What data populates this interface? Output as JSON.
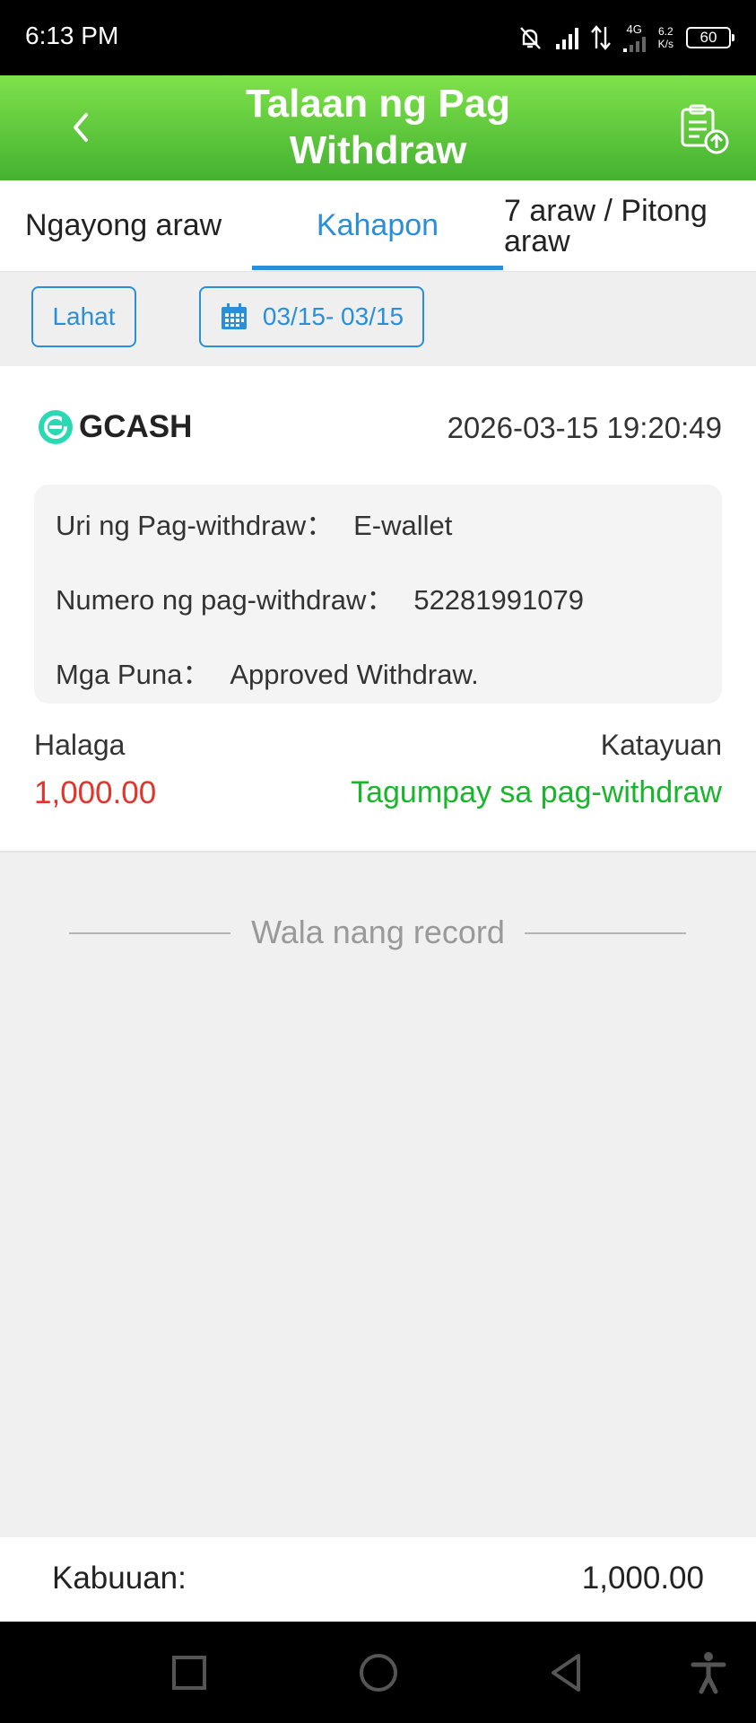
{
  "status_bar": {
    "time": "6:13 PM",
    "network": "4G",
    "speed_value": "6.2",
    "speed_unit": "K/s",
    "battery": "60",
    "icons": [
      "mute-bell-icon",
      "signal-icon",
      "data-arrows-icon",
      "signal-icon",
      "battery-icon"
    ]
  },
  "header": {
    "title": "Talaan ng Pag Withdraw",
    "back_icon": "chevron-left-icon",
    "action_icon": "clipboard-upload-icon"
  },
  "tabs": [
    {
      "label": "Ngayong araw",
      "active": false
    },
    {
      "label": "Kahapon",
      "active": true
    },
    {
      "label": "7 araw / Pitong araw",
      "active": false
    }
  ],
  "filters": {
    "all_label": "Lahat",
    "date_range": "03/15- 03/15",
    "date_icon": "calendar-icon"
  },
  "record": {
    "provider": "GCASH",
    "datetime": "2026-03-15 19:20:49",
    "details": [
      {
        "label": "Uri ng Pag-withdraw：",
        "value": "E-wallet"
      },
      {
        "label": "Numero ng pag-withdraw：",
        "value": "52281991079"
      },
      {
        "label": "Mga Puna：",
        "value": "Approved Withdraw."
      }
    ],
    "amount_label": "Halaga",
    "amount": "1,000.00",
    "status_label": "Katayuan",
    "status": "Tagumpay sa pag-withdraw"
  },
  "no_more_records": "Wala nang record",
  "total": {
    "label": "Kabuuan:",
    "value": "1,000.00"
  },
  "colors": {
    "header_green": "#5ccf3a",
    "accent_blue": "#2a8fd8",
    "amount_red": "#e3342b",
    "success_green": "#19b52a"
  }
}
